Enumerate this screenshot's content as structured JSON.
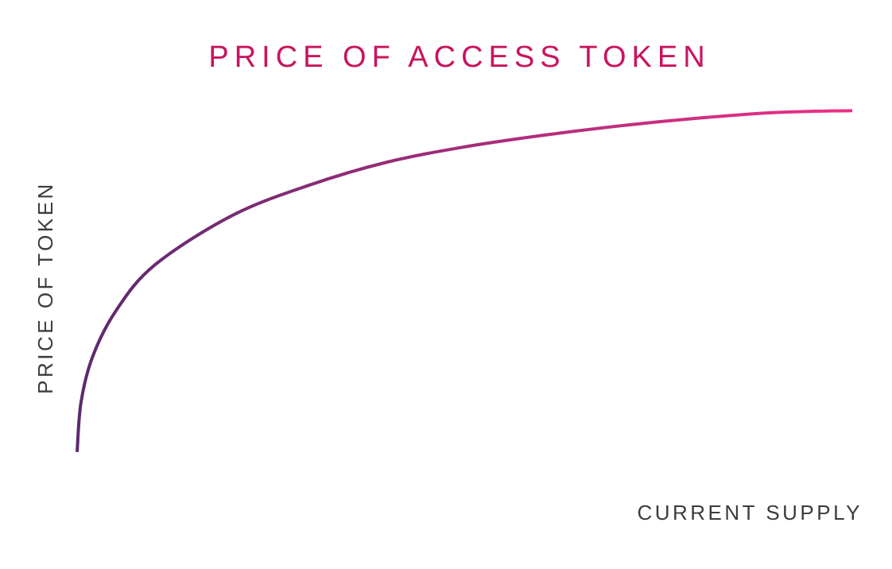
{
  "chart_data": {
    "type": "line",
    "title": "PRICE OF ACCESS TOKEN",
    "xlabel": "CURRENT SUPPLY",
    "ylabel": "PRICE OF TOKEN",
    "xlim": [
      0,
      1
    ],
    "ylim": [
      0,
      1
    ],
    "grid": false,
    "series": [
      {
        "x": [
          0,
          0.005,
          0.02,
          0.05,
          0.1,
          0.2,
          0.3,
          0.4,
          0.5,
          0.6,
          0.7,
          0.8,
          0.9,
          1.0
        ],
        "values": [
          0.09,
          0.22,
          0.34,
          0.46,
          0.58,
          0.71,
          0.79,
          0.85,
          0.89,
          0.92,
          0.945,
          0.965,
          0.98,
          0.985
        ]
      }
    ],
    "colors": {
      "title": "#c8145f",
      "axis_label": "#3b3b40",
      "gradient_start": "#5b2a6e",
      "gradient_end": "#ee2f86"
    }
  }
}
